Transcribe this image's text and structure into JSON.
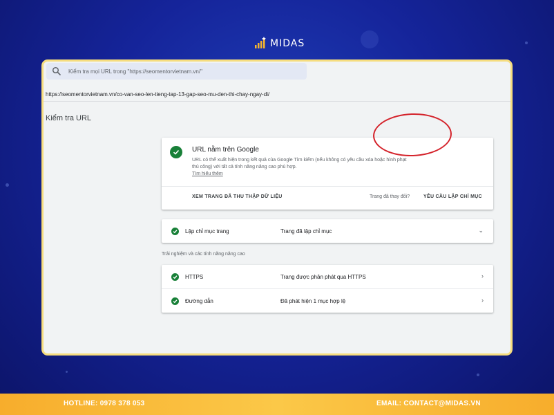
{
  "brand": {
    "name": "MIDAS"
  },
  "search": {
    "placeholder": "Kiểm tra mọi URL trong \"https://seomentorvietnam.vn/\""
  },
  "inspected_url": "https://seomentorvietnam.vn/co-van-seo-len-tieng-tap-13-gap-seo-mu-den-thi-chay-ngay-di/",
  "page_title": "Kiểm tra URL",
  "status_card": {
    "title": "URL nằm trên Google",
    "description": "URL có thể xuất hiện trong kết quả của Google Tìm kiếm (nếu không có yêu cầu xóa hoặc hình phạt thủ công) với tất cả tính năng nâng cao phù hợp.",
    "learn_more": "Tìm hiểu thêm",
    "view_crawled_label": "XEM TRANG ĐÃ THU THẬP DỮ LIỆU",
    "changed_text": "Trang đã thay đổi?",
    "request_index_label": "YÊU CẦU LẬP CHỈ MỤC"
  },
  "index_row": {
    "label": "Lập chỉ mục trang",
    "value": "Trang đã lập chỉ mục",
    "arrow": "⌄"
  },
  "enhancements_label": "Trải nghiệm và các tính năng nâng cao",
  "enhancements": [
    {
      "label": "HTTPS",
      "value": "Trang được phân phát qua HTTPS",
      "arrow": "›"
    },
    {
      "label": "Đường dẫn",
      "value": "Đã phát hiện 1 mục hợp lệ",
      "arrow": "›"
    }
  ],
  "footer": {
    "hotline": "HOTLINE: 0978 378 053",
    "email": "EMAIL: CONTACT@MIDAS.VN"
  },
  "colors": {
    "background": "#15249a",
    "accent_border": "#f6dd7e",
    "check_green": "#188038",
    "highlight_red": "#d4232b",
    "footer": "#fbc848"
  }
}
